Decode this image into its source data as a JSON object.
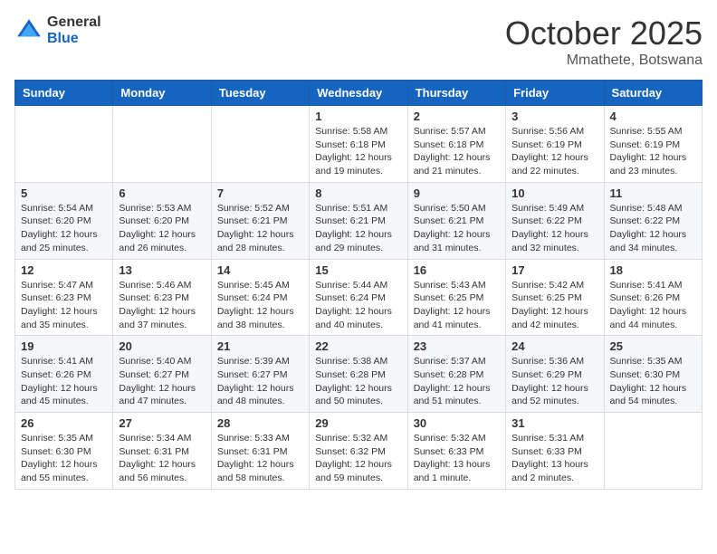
{
  "header": {
    "logo": {
      "general": "General",
      "blue": "Blue"
    },
    "title": "October 2025",
    "location": "Mmathete, Botswana"
  },
  "weekdays": [
    "Sunday",
    "Monday",
    "Tuesday",
    "Wednesday",
    "Thursday",
    "Friday",
    "Saturday"
  ],
  "weeks": [
    [
      {
        "day": "",
        "info": ""
      },
      {
        "day": "",
        "info": ""
      },
      {
        "day": "",
        "info": ""
      },
      {
        "day": "1",
        "info": "Sunrise: 5:58 AM\nSunset: 6:18 PM\nDaylight: 12 hours\nand 19 minutes."
      },
      {
        "day": "2",
        "info": "Sunrise: 5:57 AM\nSunset: 6:18 PM\nDaylight: 12 hours\nand 21 minutes."
      },
      {
        "day": "3",
        "info": "Sunrise: 5:56 AM\nSunset: 6:19 PM\nDaylight: 12 hours\nand 22 minutes."
      },
      {
        "day": "4",
        "info": "Sunrise: 5:55 AM\nSunset: 6:19 PM\nDaylight: 12 hours\nand 23 minutes."
      }
    ],
    [
      {
        "day": "5",
        "info": "Sunrise: 5:54 AM\nSunset: 6:20 PM\nDaylight: 12 hours\nand 25 minutes."
      },
      {
        "day": "6",
        "info": "Sunrise: 5:53 AM\nSunset: 6:20 PM\nDaylight: 12 hours\nand 26 minutes."
      },
      {
        "day": "7",
        "info": "Sunrise: 5:52 AM\nSunset: 6:21 PM\nDaylight: 12 hours\nand 28 minutes."
      },
      {
        "day": "8",
        "info": "Sunrise: 5:51 AM\nSunset: 6:21 PM\nDaylight: 12 hours\nand 29 minutes."
      },
      {
        "day": "9",
        "info": "Sunrise: 5:50 AM\nSunset: 6:21 PM\nDaylight: 12 hours\nand 31 minutes."
      },
      {
        "day": "10",
        "info": "Sunrise: 5:49 AM\nSunset: 6:22 PM\nDaylight: 12 hours\nand 32 minutes."
      },
      {
        "day": "11",
        "info": "Sunrise: 5:48 AM\nSunset: 6:22 PM\nDaylight: 12 hours\nand 34 minutes."
      }
    ],
    [
      {
        "day": "12",
        "info": "Sunrise: 5:47 AM\nSunset: 6:23 PM\nDaylight: 12 hours\nand 35 minutes."
      },
      {
        "day": "13",
        "info": "Sunrise: 5:46 AM\nSunset: 6:23 PM\nDaylight: 12 hours\nand 37 minutes."
      },
      {
        "day": "14",
        "info": "Sunrise: 5:45 AM\nSunset: 6:24 PM\nDaylight: 12 hours\nand 38 minutes."
      },
      {
        "day": "15",
        "info": "Sunrise: 5:44 AM\nSunset: 6:24 PM\nDaylight: 12 hours\nand 40 minutes."
      },
      {
        "day": "16",
        "info": "Sunrise: 5:43 AM\nSunset: 6:25 PM\nDaylight: 12 hours\nand 41 minutes."
      },
      {
        "day": "17",
        "info": "Sunrise: 5:42 AM\nSunset: 6:25 PM\nDaylight: 12 hours\nand 42 minutes."
      },
      {
        "day": "18",
        "info": "Sunrise: 5:41 AM\nSunset: 6:26 PM\nDaylight: 12 hours\nand 44 minutes."
      }
    ],
    [
      {
        "day": "19",
        "info": "Sunrise: 5:41 AM\nSunset: 6:26 PM\nDaylight: 12 hours\nand 45 minutes."
      },
      {
        "day": "20",
        "info": "Sunrise: 5:40 AM\nSunset: 6:27 PM\nDaylight: 12 hours\nand 47 minutes."
      },
      {
        "day": "21",
        "info": "Sunrise: 5:39 AM\nSunset: 6:27 PM\nDaylight: 12 hours\nand 48 minutes."
      },
      {
        "day": "22",
        "info": "Sunrise: 5:38 AM\nSunset: 6:28 PM\nDaylight: 12 hours\nand 50 minutes."
      },
      {
        "day": "23",
        "info": "Sunrise: 5:37 AM\nSunset: 6:28 PM\nDaylight: 12 hours\nand 51 minutes."
      },
      {
        "day": "24",
        "info": "Sunrise: 5:36 AM\nSunset: 6:29 PM\nDaylight: 12 hours\nand 52 minutes."
      },
      {
        "day": "25",
        "info": "Sunrise: 5:35 AM\nSunset: 6:30 PM\nDaylight: 12 hours\nand 54 minutes."
      }
    ],
    [
      {
        "day": "26",
        "info": "Sunrise: 5:35 AM\nSunset: 6:30 PM\nDaylight: 12 hours\nand 55 minutes."
      },
      {
        "day": "27",
        "info": "Sunrise: 5:34 AM\nSunset: 6:31 PM\nDaylight: 12 hours\nand 56 minutes."
      },
      {
        "day": "28",
        "info": "Sunrise: 5:33 AM\nSunset: 6:31 PM\nDaylight: 12 hours\nand 58 minutes."
      },
      {
        "day": "29",
        "info": "Sunrise: 5:32 AM\nSunset: 6:32 PM\nDaylight: 12 hours\nand 59 minutes."
      },
      {
        "day": "30",
        "info": "Sunrise: 5:32 AM\nSunset: 6:33 PM\nDaylight: 13 hours\nand 1 minute."
      },
      {
        "day": "31",
        "info": "Sunrise: 5:31 AM\nSunset: 6:33 PM\nDaylight: 13 hours\nand 2 minutes."
      },
      {
        "day": "",
        "info": ""
      }
    ]
  ]
}
